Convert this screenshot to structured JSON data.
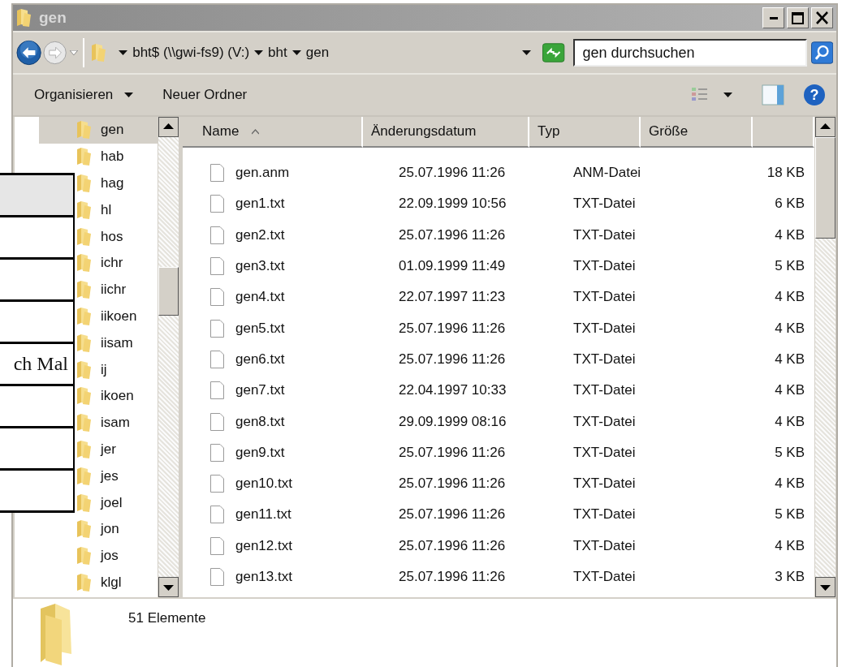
{
  "window": {
    "title": "gen"
  },
  "address_bar": {
    "path": [
      "bht$ (\\\\gwi-fs9) (V:)",
      "bht",
      "gen"
    ],
    "search": {
      "placeholder": "gen durchsuchen"
    }
  },
  "toolbar": {
    "buttons": [
      {
        "label": "Organisieren",
        "dropdown": true
      },
      {
        "label": "Neuer Ordner",
        "dropdown": false
      }
    ]
  },
  "sidebar": {
    "items": [
      {
        "label": "gen",
        "selected": true
      },
      {
        "label": "hab",
        "selected": false
      },
      {
        "label": "hag",
        "selected": false
      },
      {
        "label": "hl",
        "selected": false
      },
      {
        "label": "hos",
        "selected": false
      },
      {
        "label": "ichr",
        "selected": false
      },
      {
        "label": "iichr",
        "selected": false
      },
      {
        "label": "iikoen",
        "selected": false
      },
      {
        "label": "iisam",
        "selected": false
      },
      {
        "label": "ij",
        "selected": false
      },
      {
        "label": "ikoen",
        "selected": false
      },
      {
        "label": "isam",
        "selected": false
      },
      {
        "label": "jer",
        "selected": false
      },
      {
        "label": "jes",
        "selected": false
      },
      {
        "label": "joel",
        "selected": false
      },
      {
        "label": "jon",
        "selected": false
      },
      {
        "label": "jos",
        "selected": false
      },
      {
        "label": "klgl",
        "selected": false
      }
    ]
  },
  "help_button": {
    "label": "?"
  },
  "table": {
    "columns": [
      {
        "label": "Name",
        "sorted": true
      },
      {
        "label": "Änderungsdatum",
        "sorted": false
      },
      {
        "label": "Typ",
        "sorted": false
      },
      {
        "label": "Größe",
        "sorted": false
      }
    ],
    "rows": [
      [
        "gen.anm",
        "25.07.1996 11:26",
        "ANM-Datei",
        "18 KB"
      ],
      [
        "gen1.txt",
        "22.09.1999 10:56",
        "TXT-Datei",
        "6 KB"
      ],
      [
        "gen2.txt",
        "25.07.1996 11:26",
        "TXT-Datei",
        "4 KB"
      ],
      [
        "gen3.txt",
        "01.09.1999 11:49",
        "TXT-Datei",
        "5 KB"
      ],
      [
        "gen4.txt",
        "22.07.1997 11:23",
        "TXT-Datei",
        "4 KB"
      ],
      [
        "gen5.txt",
        "25.07.1996 11:26",
        "TXT-Datei",
        "4 KB"
      ],
      [
        "gen6.txt",
        "25.07.1996 11:26",
        "TXT-Datei",
        "4 KB"
      ],
      [
        "gen7.txt",
        "22.04.1997 10:33",
        "TXT-Datei",
        "4 KB"
      ],
      [
        "gen8.txt",
        "29.09.1999 08:16",
        "TXT-Datei",
        "4 KB"
      ],
      [
        "gen9.txt",
        "25.07.1996 11:26",
        "TXT-Datei",
        "5 KB"
      ],
      [
        "gen10.txt",
        "25.07.1996 11:26",
        "TXT-Datei",
        "4 KB"
      ],
      [
        "gen11.txt",
        "25.07.1996 11:26",
        "TXT-Datei",
        "5 KB"
      ],
      [
        "gen12.txt",
        "25.07.1996 11:26",
        "TXT-Datei",
        "4 KB"
      ],
      [
        "gen13.txt",
        "25.07.1996 11:26",
        "TXT-Datei",
        "3 KB"
      ]
    ]
  },
  "status_bar": {
    "count": "51 Elemente"
  },
  "overlay_table": {
    "rows": [
      {
        "shaded": true
      },
      {
        "shaded": false
      },
      {
        "shaded": false
      },
      {
        "shaded": false
      },
      {
        "shaded": false,
        "text": "ch Mal"
      },
      {
        "shaded": false
      },
      {
        "shaded": false
      },
      {
        "shaded": false
      }
    ]
  }
}
